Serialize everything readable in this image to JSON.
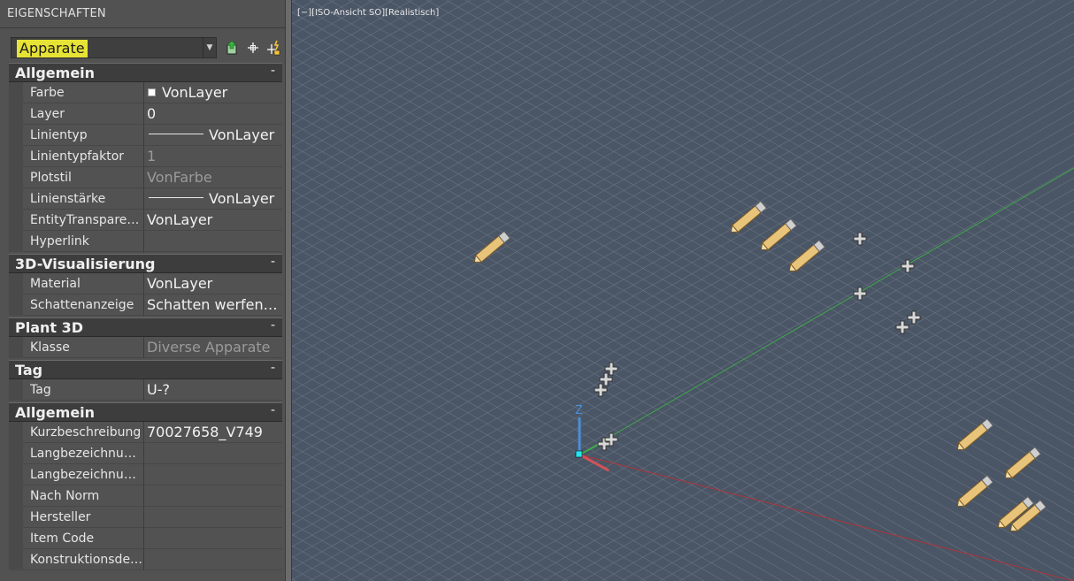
{
  "panel": {
    "title": "EIGENSCHAFTEN",
    "selector": {
      "value": "Apparate",
      "highlight_color": "#e6e336"
    },
    "tools": [
      "quick-select-icon",
      "select-objects-icon",
      "toggle-pickadd-icon"
    ]
  },
  "groups": [
    {
      "title": "Allgemein",
      "toggle": "-",
      "rows": [
        {
          "label": "Farbe",
          "value": "VonLayer",
          "swatch": true
        },
        {
          "label": "Layer",
          "value": "0"
        },
        {
          "label": "Linientyp",
          "value": "VonLayer",
          "line": true
        },
        {
          "label": "Linientypfaktor",
          "value": "1",
          "dim": true
        },
        {
          "label": "Plotstil",
          "value": "VonFarbe",
          "dim": true
        },
        {
          "label": "Linienstärke",
          "value": "VonLayer",
          "line": true
        },
        {
          "label": "EntityTransparen…",
          "value": "VonLayer"
        },
        {
          "label": "Hyperlink",
          "value": ""
        }
      ]
    },
    {
      "title": "3D-Visualisierung",
      "toggle": "-",
      "rows": [
        {
          "label": "Material",
          "value": "VonLayer"
        },
        {
          "label": "Schattenanzeige",
          "value": "Schatten werfen…"
        }
      ]
    },
    {
      "title": "Plant 3D",
      "toggle": "-",
      "rows": [
        {
          "label": "Klasse",
          "value": "Diverse Apparate",
          "dim": true
        }
      ]
    },
    {
      "title": "Tag",
      "toggle": "-",
      "rows": [
        {
          "label": "Tag",
          "value": "U-?"
        }
      ]
    },
    {
      "title": "Allgemein",
      "toggle": "-",
      "rows": [
        {
          "label": "Kurzbeschreibung",
          "value": "70027658_V749"
        },
        {
          "label": "Langbezeichnun…",
          "value": ""
        },
        {
          "label": "Langbezeichnun…",
          "value": ""
        },
        {
          "label": "Nach Norm",
          "value": ""
        },
        {
          "label": "Hersteller",
          "value": ""
        },
        {
          "label": "Item Code",
          "value": ""
        },
        {
          "label": "Konstruktionsde…",
          "value": ""
        }
      ]
    }
  ],
  "viewport": {
    "label": "[−][ISO-Ansicht SO][Realistisch]",
    "ucs_axis_label": "Z",
    "colors": {
      "grid": "#65707f",
      "x_axis": "#b0343a",
      "y_axis": "#3fa84a",
      "z_axis": "#4a8fd8"
    },
    "marker_icons": [
      "pencil-icon",
      "point-cross-icon"
    ]
  }
}
